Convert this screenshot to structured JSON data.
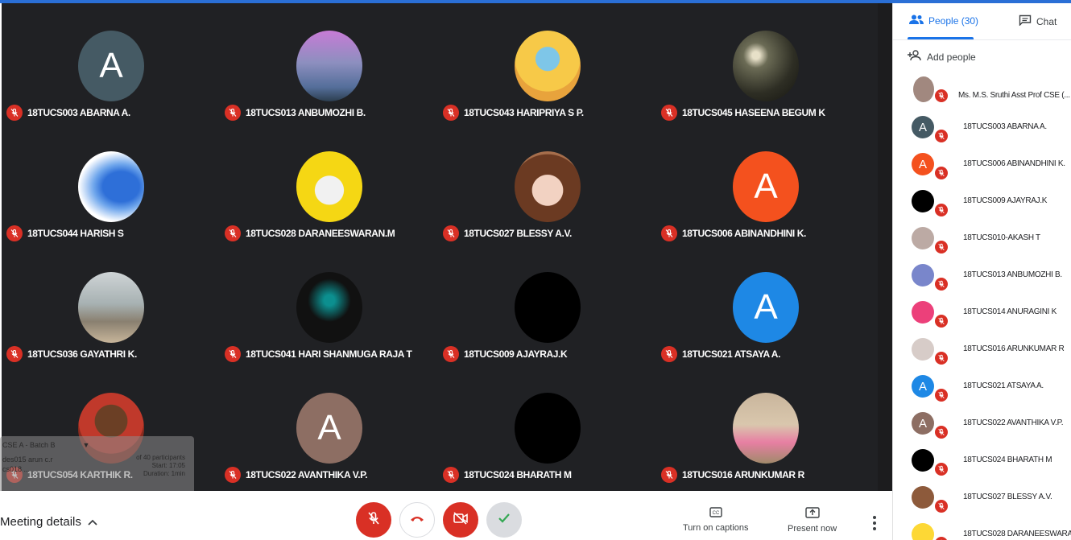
{
  "tiles": [
    {
      "name": "18TUCS003 ABARNA A.",
      "avatar": "letter",
      "letter": "A",
      "color": "#455a64"
    },
    {
      "name": "18TUCS013 ANBUMOZHI B.",
      "avatar": "photo-balloons"
    },
    {
      "name": "18TUCS043 HARIPRIYA S P.",
      "avatar": "photo-krishna"
    },
    {
      "name": "18TUCS045 HASEENA BEGUM K",
      "avatar": "photo-dark-bokeh"
    },
    {
      "name": "18TUCS044 HARISH S",
      "avatar": "photo-blue-splash"
    },
    {
      "name": "18TUCS028 DARANEESWARAN.M",
      "avatar": "photo-yellow-man"
    },
    {
      "name": "18TUCS027 BLESSY A.V.",
      "avatar": "photo-doll"
    },
    {
      "name": "18TUCS006 ABINANDHINI K.",
      "avatar": "letter",
      "letter": "A",
      "color": "#f4511e"
    },
    {
      "name": "18TUCS036 GAYATHRI K.",
      "avatar": "photo-sea"
    },
    {
      "name": "18TUCS041 HARI SHANMUGA RAJA T",
      "avatar": "photo-hsr"
    },
    {
      "name": "18TUCS009 AJAYRAJ.K",
      "avatar": "black"
    },
    {
      "name": "18TUCS021 ATSAYA A.",
      "avatar": "letter",
      "letter": "A",
      "color": "#1e88e5"
    },
    {
      "name": "18TUCS054 KARTHIK R.",
      "avatar": "photo-man-red"
    },
    {
      "name": "18TUCS022 AVANTHIKA V.P.",
      "avatar": "letter",
      "letter": "A",
      "color": "#8d6e63"
    },
    {
      "name": "18TUCS024 BHARATH M",
      "avatar": "black"
    },
    {
      "name": "18TUCS016 ARUNKUMAR R",
      "avatar": "photo-pink-shirt"
    }
  ],
  "widget": {
    "title": "CSE A - Batch B",
    "line1": "des015 arun c.r",
    "line2": "cs018 ...",
    "participants": "of 40 participants",
    "start": "Start: 17:05",
    "duration": "Duration: 1min"
  },
  "bottombar": {
    "meeting_details": "Meeting details",
    "captions_label": "Turn on captions",
    "present_label": "Present now"
  },
  "panel": {
    "people_tab": "People (30)",
    "chat_tab": "Chat",
    "add_people": "Add people",
    "people": [
      {
        "name": "Ms. M.S. Sruthi Asst Prof CSE (...",
        "avatar": "photo",
        "color": "#a1887f",
        "host": true
      },
      {
        "name": "18TUCS003 ABARNA A.",
        "avatar": "letter",
        "letter": "A",
        "color": "#455a64"
      },
      {
        "name": "18TUCS006 ABINANDHINI K.",
        "avatar": "letter",
        "letter": "A",
        "color": "#f4511e"
      },
      {
        "name": "18TUCS009 AJAYRAJ.K",
        "avatar": "black",
        "color": "#000000"
      },
      {
        "name": "18TUCS010-AKASH T",
        "avatar": "photo",
        "color": "#bcaaa4"
      },
      {
        "name": "18TUCS013 ANBUMOZHI B.",
        "avatar": "photo",
        "color": "#7986cb"
      },
      {
        "name": "18TUCS014 ANURAGINI K",
        "avatar": "photo",
        "color": "#ec407a"
      },
      {
        "name": "18TUCS016 ARUNKUMAR R",
        "avatar": "photo",
        "color": "#d7ccc8"
      },
      {
        "name": "18TUCS021 ATSAYA A.",
        "avatar": "letter",
        "letter": "A",
        "color": "#1e88e5"
      },
      {
        "name": "18TUCS022 AVANTHIKA V.P.",
        "avatar": "letter",
        "letter": "A",
        "color": "#8d6e63"
      },
      {
        "name": "18TUCS024 BHARATH M",
        "avatar": "black",
        "color": "#000000"
      },
      {
        "name": "18TUCS027 BLESSY A.V.",
        "avatar": "photo",
        "color": "#8d5a3b"
      },
      {
        "name": "18TUCS028 DARANEESWARA...",
        "avatar": "photo",
        "color": "#fdd835"
      }
    ]
  }
}
